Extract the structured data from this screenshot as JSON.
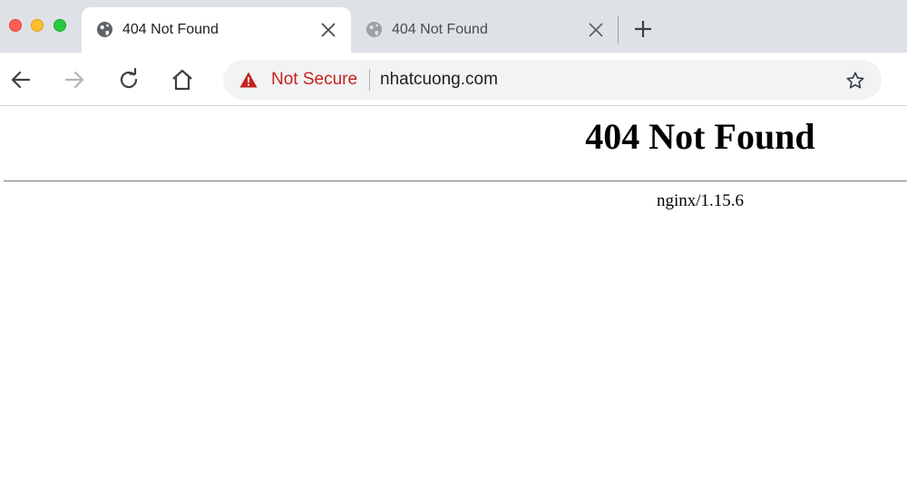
{
  "tabs": [
    {
      "title": "404 Not Found",
      "icon": "globe-icon",
      "active": true
    },
    {
      "title": "404 Not Found",
      "icon": "globe-icon",
      "active": false
    }
  ],
  "toolbar": {
    "security_label": "Not Secure",
    "security_icon": "warning-triangle-icon",
    "url": "nhatcuong.com"
  },
  "page": {
    "heading": "404 Not Found",
    "server": "nginx/1.15.6"
  },
  "colors": {
    "tabstrip_bg": "#dee1e6",
    "warning_red": "#c5221f",
    "omnibox_bg": "#f1f3f4"
  }
}
